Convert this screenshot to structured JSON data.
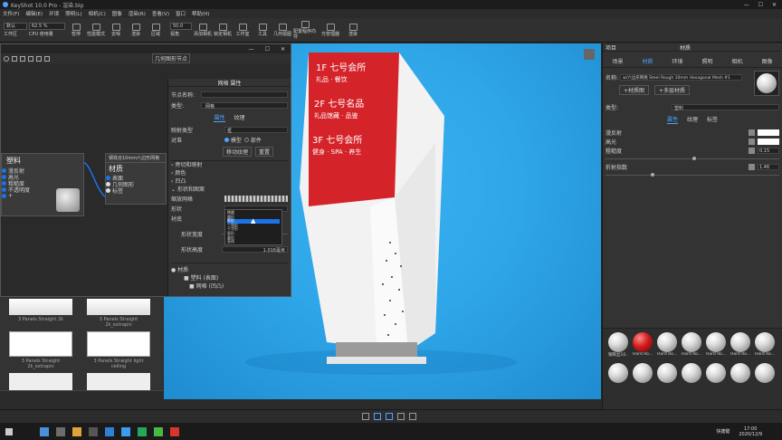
{
  "titlebar": {
    "title": "KeyShot 10.0 Pro - 渲染.bip",
    "controls": [
      "—",
      "☐",
      "✕"
    ]
  },
  "menu": [
    "文件(F)",
    "编辑(E)",
    "环境",
    "照明(L)",
    "相机(C)",
    "图像",
    "渲染(R)",
    "查看(V)",
    "窗口",
    "帮助(H)"
  ],
  "toolbar": {
    "workspace_sel": "默认",
    "cpu": "CPU",
    "percent": "62.5 %",
    "fps": "50.0",
    "items": [
      "工作区",
      "CPU 使用量",
      "暂停",
      "性能模式",
      "去噪",
      "渲染",
      "区域",
      "视角",
      "添加相机",
      "锁定相机",
      "工作室",
      "工具",
      "几何视图",
      "配置程序向导",
      "光管理器",
      "渲染"
    ]
  },
  "graph": {
    "title": "网格 属性",
    "toolbar_label": "几何图形节点",
    "node_plastic": {
      "title": "塑料",
      "ports": [
        "漫反射",
        "高光",
        "粗糙度",
        "不透明度",
        "+"
      ]
    },
    "node_material": {
      "header": "钢铁丝10mm六边形网格",
      "title": "材质",
      "ports": [
        "表面",
        "几何图形",
        "标签"
      ]
    }
  },
  "props": {
    "node_name_label": "节点名称:",
    "type_label": "类型:",
    "type_value": "网格",
    "tabs": [
      "属性",
      "纹理"
    ],
    "mapping_label": "映射类型",
    "mapping_value": "框",
    "align_label": "对准",
    "align_opts": [
      "模型",
      "部件"
    ],
    "buttons": [
      "移动纹理",
      "重置"
    ],
    "sections": [
      "旁切和映射",
      "颜色",
      "凹凸",
      "形状和图案"
    ],
    "shape_label": "形状",
    "bg_label": "衬底",
    "width_label": "形状宽度",
    "height_label": "形状高度",
    "height_val": "1.016毫米",
    "scale_label": "缩放网格",
    "dropdown": [
      "椭圆",
      "圆形",
      "矩形",
      "三角形",
      "十字形",
      "星形",
      "菱形",
      "直线"
    ],
    "tree": [
      "材质",
      "塑料 (表面)",
      "网格 (凹凸)"
    ]
  },
  "library": {
    "items": [
      [
        "3 Panels Straight 2k",
        "3 Panels Straight 2k_extrapin"
      ],
      [
        "3 Panels Straight 2k_extrapin",
        "3 Panels Straight light ceiling"
      ],
      [
        "",
        ""
      ]
    ]
  },
  "right": {
    "header_left": "项目",
    "header_title": "材质",
    "tabs": [
      "场景",
      "材质",
      "环境",
      "照明",
      "相机",
      "图像"
    ],
    "name_label": "名称:",
    "name_value": "w/六边形网格 Steel Rough 10mm Hexagonal Mesh #1",
    "btn_texture": "+材质图",
    "btn_multi": "+多层材质",
    "type_label": "类型:",
    "type_value": "塑料",
    "subtabs": [
      "属性",
      "纹理",
      "标签"
    ],
    "props": [
      {
        "label": "漫反射",
        "val": ""
      },
      {
        "label": "高光",
        "val": ""
      },
      {
        "label": "粗糙度",
        "val": "0.15"
      },
      {
        "label": "折射指数",
        "val": "1.46"
      }
    ],
    "thumbs": [
      "钢铁丝10...",
      "Hard Ro...",
      "Hard Ro...",
      "Hard Ro...",
      "Hard Ro...",
      "Hard Ro...",
      "Hard Ro..."
    ]
  },
  "taskbar": {
    "time": "17:00",
    "date": "2020/12/9",
    "shortcut": "快捷键"
  },
  "signage": {
    "lines": [
      "1F 七号会所",
      "2F 七号名品",
      "3F 七号会所"
    ],
    "sub": [
      "礼品 · 餐饮",
      "礼品馆藏 · 品鉴",
      "健身 · SPA · 养生"
    ]
  }
}
